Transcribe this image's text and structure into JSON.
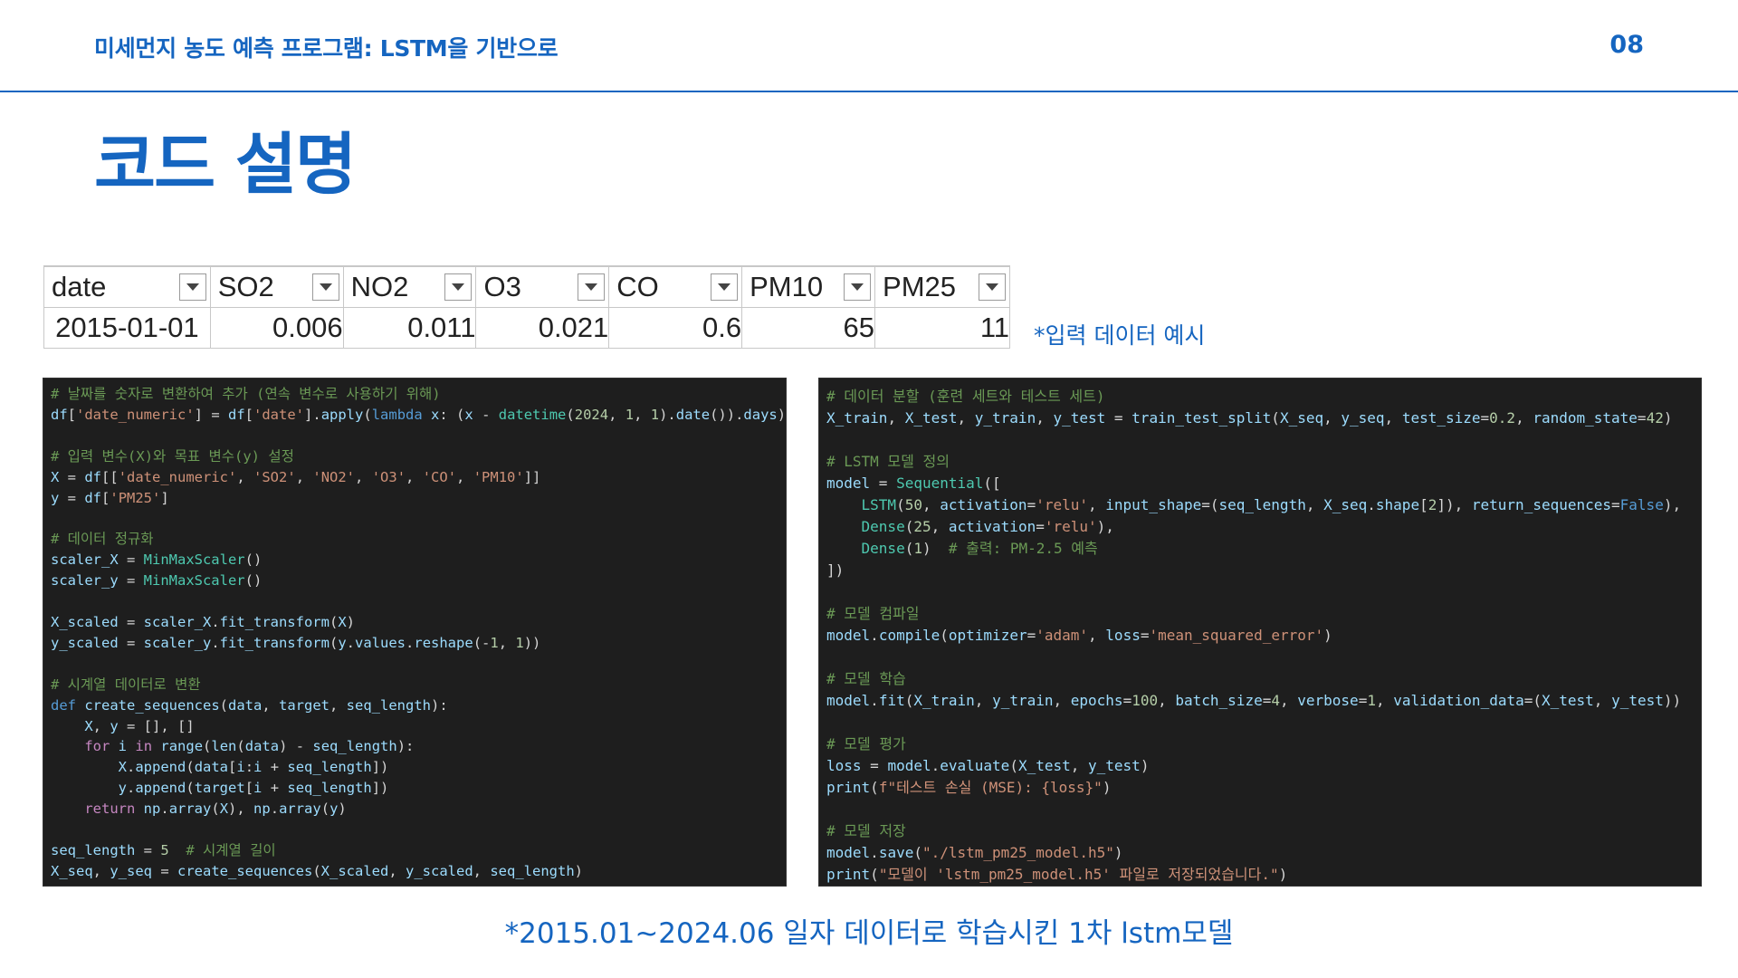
{
  "header": {
    "title": "미세먼지 농도 예측 프로그램: LSTM을 기반으로",
    "page_number": "08"
  },
  "main_title": "코드 설명",
  "spreadsheet": {
    "columns": [
      "date",
      "SO2",
      "NO2",
      "O3",
      "CO",
      "PM10",
      "PM25"
    ],
    "row": [
      "2015-01-01",
      "0.006",
      "0.011",
      "0.021",
      "0.6",
      "65",
      "11"
    ]
  },
  "input_caption": "*입력 데이터 예시",
  "code_left": [
    "# 날짜를 숫자로 변환하여 추가 (연속 변수로 사용하기 위해)",
    "df['date_numeric'] = df['date'].apply(lambda x: (x - datetime(2024, 1, 1).date()).days)",
    "",
    "# 입력 변수(X)와 목표 변수(y) 설정",
    "X = df[['date_numeric', 'SO2', 'NO2', 'O3', 'CO', 'PM10']]",
    "y = df['PM25']",
    "",
    "# 데이터 정규화",
    "scaler_X = MinMaxScaler()",
    "scaler_y = MinMaxScaler()",
    "",
    "X_scaled = scaler_X.fit_transform(X)",
    "y_scaled = scaler_y.fit_transform(y.values.reshape(-1, 1))",
    "",
    "# 시계열 데이터로 변환",
    "def create_sequences(data, target, seq_length):",
    "    X, y = [], []",
    "    for i in range(len(data) - seq_length):",
    "        X.append(data[i:i + seq_length])",
    "        y.append(target[i + seq_length])",
    "    return np.array(X), np.array(y)",
    "",
    "seq_length = 5  # 시계열 길이",
    "X_seq, y_seq = create_sequences(X_scaled, y_scaled, seq_length)"
  ],
  "code_right": [
    "# 데이터 분할 (훈련 세트와 테스트 세트)",
    "X_train, X_test, y_train, y_test = train_test_split(X_seq, y_seq, test_size=0.2, random_state=42)",
    "",
    "# LSTM 모델 정의",
    "model = Sequential([",
    "    LSTM(50, activation='relu', input_shape=(seq_length, X_seq.shape[2]), return_sequences=False),",
    "    Dense(25, activation='relu'),",
    "    Dense(1)  # 출력: PM-2.5 예측",
    "])",
    "",
    "# 모델 컴파일",
    "model.compile(optimizer='adam', loss='mean_squared_error')",
    "",
    "# 모델 학습",
    "model.fit(X_train, y_train, epochs=100, batch_size=4, verbose=1, validation_data=(X_test, y_test))",
    "",
    "# 모델 평가",
    "loss = model.evaluate(X_test, y_test)",
    "print(f\"테스트 손실 (MSE): {loss}\")",
    "",
    "# 모델 저장",
    "model.save(\"./lstm_pm25_model.h5\")",
    "print(\"모델이 'lstm_pm25_model.h5' 파일로 저장되었습니다.\")"
  ],
  "bottom_caption": "*2015.01~2024.06 일자 데이터로 학습시킨 1차 lstm모델"
}
